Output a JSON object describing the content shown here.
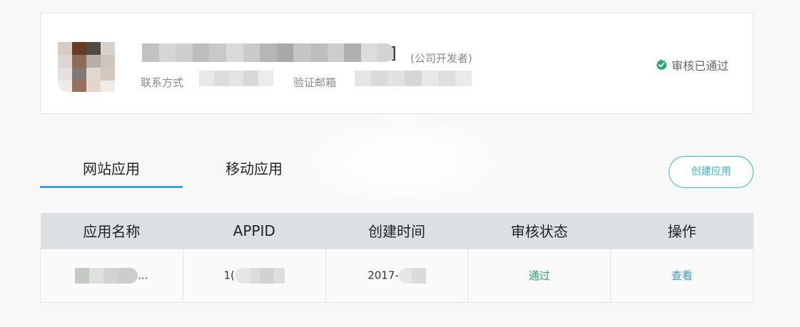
{
  "profile": {
    "name_suffix": "]",
    "role": "(公司开发者)",
    "contact_label": "联系方式",
    "email_label": "验证邮箱",
    "verify_status": "审核已通过",
    "verify_color": "#2aa66e",
    "avatar_icon": "user-avatar"
  },
  "tabs": [
    {
      "label": "网站应用",
      "active": true
    },
    {
      "label": "移动应用",
      "active": false
    }
  ],
  "create_button": "创建应用",
  "table": {
    "headers": [
      "应用名称",
      "APPID",
      "创建时间",
      "审核状态",
      "操作"
    ],
    "rows": [
      {
        "name_suffix": "...",
        "appid_prefix": "1(",
        "created_prefix": "2017-",
        "status": "通过",
        "action": "查看"
      }
    ]
  },
  "colors": {
    "accent": "#3ba3d8",
    "button": "#3bb5c9",
    "success": "#2aa66e",
    "link": "#3b9ad6"
  }
}
